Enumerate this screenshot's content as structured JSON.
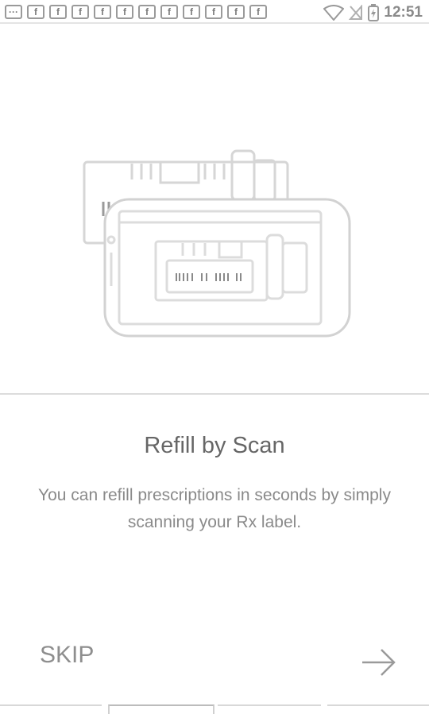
{
  "status_bar": {
    "time": "12:51",
    "notification_icons": [
      "chat-icon",
      "f",
      "f",
      "f",
      "f",
      "f",
      "f",
      "f",
      "f",
      "f",
      "f",
      "f"
    ]
  },
  "onboarding": {
    "title": "Refill by Scan",
    "description": "You can refill prescriptions in seconds by simply scanning your Rx label.",
    "skip_label": "SKIP",
    "page_count": 4,
    "current_page": 1
  },
  "colors": {
    "background": "#ffffff",
    "title": "#666666",
    "text": "#8a8a8a",
    "line": "#dcdcdc"
  }
}
